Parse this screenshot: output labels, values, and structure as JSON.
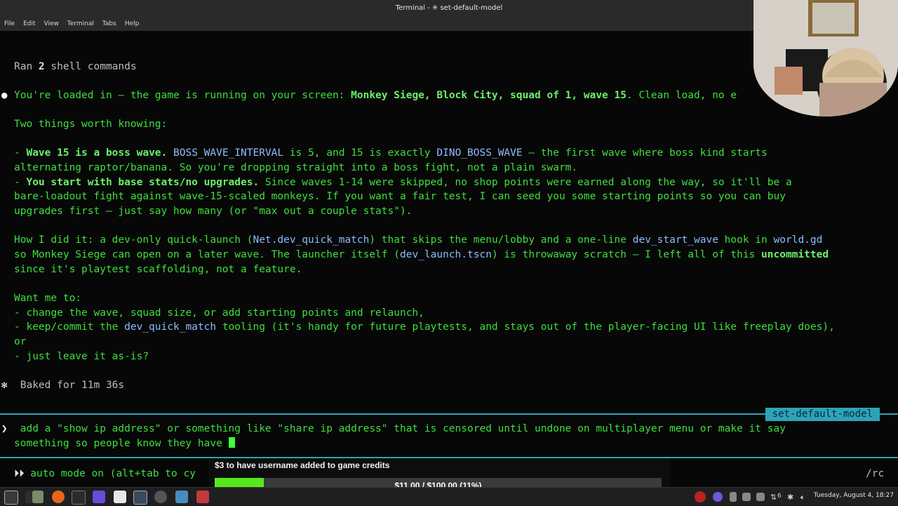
{
  "window": {
    "title": "Terminal - ✳ set-default-model"
  },
  "menu": [
    "File",
    "Edit",
    "View",
    "Terminal",
    "Tabs",
    "Help"
  ],
  "terminal": {
    "ran": {
      "pre": "Ran ",
      "num": "2",
      "post": " shell commands"
    },
    "loaded": {
      "bullet": "●",
      "a": "You're loaded in — the game is running on your screen: ",
      "b": "Monkey Siege, Block City, squad of 1, wave 15",
      "c": ". Clean load, no e"
    },
    "two_things": "Two things worth knowing:",
    "w15": {
      "dash": "- ",
      "bold": "Wave 15 is a boss wave.",
      "sp": " ",
      "code1": "BOSS_WAVE_INTERVAL",
      "m1": " is 5, and 15 is exactly ",
      "code2": "DINO_BOSS_WAVE",
      "m2": " — the first wave where boss kind starts",
      "l2": "alternating raptor/banana. So you're dropping straight into a boss fight, not a plain swarm."
    },
    "base": {
      "dash": "- ",
      "bold": "You start with base stats/no upgrades.",
      "rest": " Since waves 1-14 were skipped, no shop points were earned along the way, so it'll be a",
      "l2": "bare-loadout fight against wave-15-scaled monkeys. If you want a fair test, I can seed you some starting points so you can buy",
      "l3": "upgrades first — just say how many (or \"max out a couple stats\")."
    },
    "how": {
      "a": "How I did it: a dev-only quick-launch (",
      "code1": "Net.dev_quick_match",
      "b": ") that skips the menu/lobby and a one-line ",
      "code2": "dev_start_wave",
      "c": " hook in ",
      "code3": "world.gd",
      "d": "so Monkey Siege can open on a later wave. The launcher itself (",
      "code4": "dev_launch.tscn",
      "e": ") is throwaway scratch — I left all of this ",
      "bold": "uncommitted",
      "f": "since it's playtest scaffolding, not a feature."
    },
    "want": "Want me to:",
    "opt1": "- change the wave, squad size, or add starting points and relaunch,",
    "opt2": {
      "a": "- keep/commit the ",
      "code": "dev_quick_match",
      "b": " tooling (it's handy for future playtests, and stays out of the player-facing UI like freeplay does),",
      "c": "or"
    },
    "opt3": "- just leave it as-is?",
    "baked": {
      "icon": "✻",
      "text": " Baked for 11m 36s"
    },
    "model_tag": "set-default-model",
    "prompt": {
      "symbol": "❯",
      "l1": " add a \"show ip address\" or something like \"share ip address\" that is censored until undone on multiplayer menu or make it say",
      "l2": "something so people know they have "
    },
    "auto": {
      "arrows": "⏵⏵",
      "text": " auto mode on (alt+tab to cy",
      "right": "/rc"
    }
  },
  "overlay": {
    "label": "$3 to have username added to game credits",
    "progress_text": "$11.00 / $100.00 (11%)",
    "progress_fraction": 0.11
  },
  "taskbar": {
    "clock": "Tuesday, August  4, 18:27",
    "wifi_count": "6"
  },
  "colors": {
    "terminal_bg": "#070707",
    "text_green": "#3fdf3f",
    "code_blue": "#8fbcff",
    "accent_cyan": "#2ea3b8",
    "progress_green": "#57e81c"
  }
}
